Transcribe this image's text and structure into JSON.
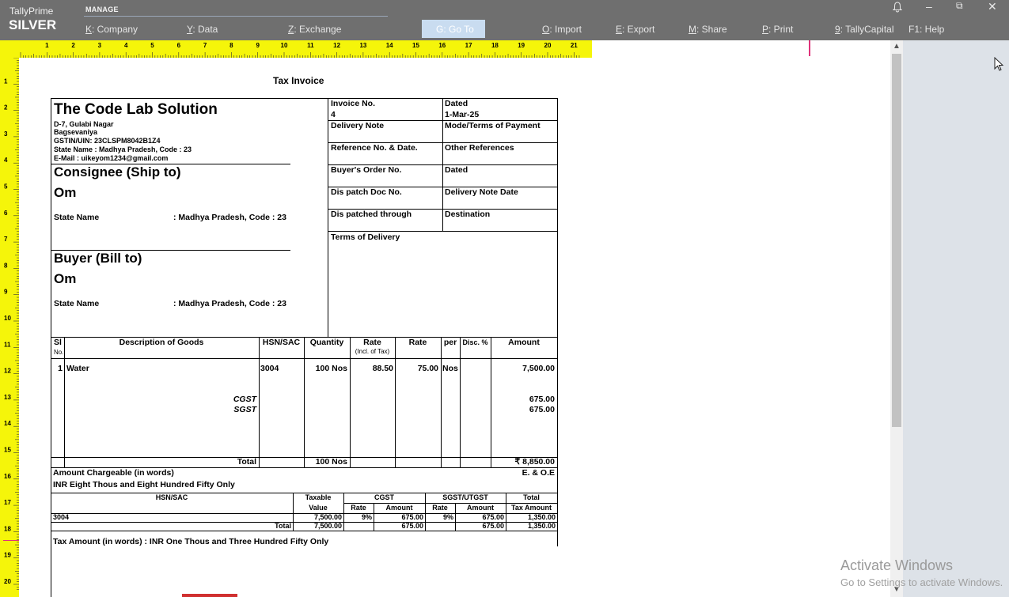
{
  "app": {
    "brand_top": "TallyPrime",
    "brand_edition": "SILVER",
    "manage_label": "MANAGE"
  },
  "menu": [
    {
      "key": "K",
      "label": ": Company"
    },
    {
      "key": "Y",
      "label": ": Data"
    },
    {
      "key": "Z",
      "label": ": Exchange"
    },
    {
      "key": "",
      "label": "G: Go To"
    },
    {
      "key": "O",
      "label": ": Import"
    },
    {
      "key": "E",
      "label": ": Export"
    },
    {
      "key": "M",
      "label": ": Share"
    },
    {
      "key": "P",
      "label": ": Print"
    },
    {
      "key": "9",
      "label": ": TallyCapital"
    },
    {
      "key": "",
      "label": "F1: Help"
    }
  ],
  "window_controls": {
    "bell": "bell-icon",
    "minimize": "–",
    "restore": "⧉",
    "close": "✕"
  },
  "ruler": {
    "top_numbers": [
      "1",
      "2",
      "3",
      "4",
      "5",
      "6",
      "7",
      "8",
      "9",
      "10",
      "11",
      "12",
      "13",
      "14",
      "15",
      "16",
      "17",
      "18",
      "19",
      "20",
      "21"
    ],
    "left_numbers": [
      "1",
      "2",
      "3",
      "4",
      "5",
      "6",
      "7",
      "8",
      "9",
      "10",
      "11",
      "12",
      "13",
      "14",
      "15",
      "16",
      "17",
      "18",
      "19",
      "20"
    ]
  },
  "invoice": {
    "title": "Tax Invoice",
    "company_name": "The Code Lab Solution",
    "company_addr1": "D-7, Gulabi Nagar",
    "company_addr2": "Bagsevaniya",
    "company_gstin": "GSTIN/UIN: 23CLSPM8042B1Z4",
    "company_state": "State Name :  Madhya Pradesh, Code : 23",
    "company_email": "E-Mail : uikeyom1234@gmail.com",
    "consignee_heading": "Consignee (Ship to)",
    "consignee_name": "Om",
    "consignee_state_label": "State Name",
    "consignee_state_value": ": Madhya Pradesh, Code : 23",
    "buyer_heading": "Buyer (Bill to)",
    "buyer_name": "Om",
    "buyer_state_label": "State Name",
    "buyer_state_value": ": Madhya Pradesh, Code : 23",
    "fields": {
      "invoice_no_label": "Invoice No.",
      "invoice_no": "4",
      "dated_label": "Dated",
      "dated": "1-Mar-25",
      "delivery_note": "Delivery Note",
      "mode_terms": "Mode/Terms of Payment",
      "reference": "Reference No. & Date.",
      "other_refs": "Other References",
      "buyers_order": "Buyer's Order No.",
      "dated2": "Dated",
      "dispatch_doc": "Dis patch Doc No.",
      "delivery_note_date": "Delivery Note Date",
      "dispatched_through": "Dis patched through",
      "destination": "Destination",
      "terms_delivery": "Terms of Delivery"
    },
    "table_headers": {
      "sl": "Sl",
      "no": "No.",
      "desc": "Description of Goods",
      "hsn": "HSN/SAC",
      "qty": "Quantity",
      "rate_incl": "Rate",
      "rate_incl_sub": "(Incl. of Tax)",
      "rate": "Rate",
      "per": "per",
      "disc": "Disc. %",
      "amount": "Amount"
    },
    "item": {
      "sl": "1",
      "desc": "Water",
      "hsn": "3004",
      "qty": "100 Nos",
      "rate_incl": "88.50",
      "rate": "75.00",
      "per": "Nos",
      "amount": "7,500.00"
    },
    "tax_lines": [
      {
        "name": "CGST",
        "amount": "675.00"
      },
      {
        "name": "SGST",
        "amount": "675.00"
      }
    ],
    "total": {
      "label": "Total",
      "qty": "100 Nos",
      "amount": "₹ 8,850.00"
    },
    "words_label": "Amount Chargeable (in words)",
    "eoe": "E. & O.E",
    "words": "INR Eight Thous and Eight Hundred Fifty Only",
    "tax_table": {
      "h_hsn": "HSN/SAC",
      "h_taxable": "Taxable",
      "h_value": "Value",
      "h_cgst": "CGST",
      "h_sgst": "SGST/UTGST",
      "h_total": "Total",
      "h_rate": "Rate",
      "h_amount": "Amount",
      "h_tax_amount": "Tax Amount",
      "row": {
        "hsn": "3004",
        "taxable": "7,500.00",
        "cgst_rate": "9%",
        "cgst_amt": "675.00",
        "sgst_rate": "9%",
        "sgst_amt": "675.00",
        "total": "1,350.00"
      },
      "total_row": {
        "label": "Total",
        "taxable": "7,500.00",
        "cgst_amt": "675.00",
        "sgst_amt": "675.00",
        "total": "1,350.00"
      }
    },
    "tax_words": "Tax Amount (in words) :  INR One Thous and Three Hundred Fifty Only"
  },
  "watermark": {
    "line1": "Activate Windows",
    "line2": "Go to Settings to activate Windows."
  }
}
